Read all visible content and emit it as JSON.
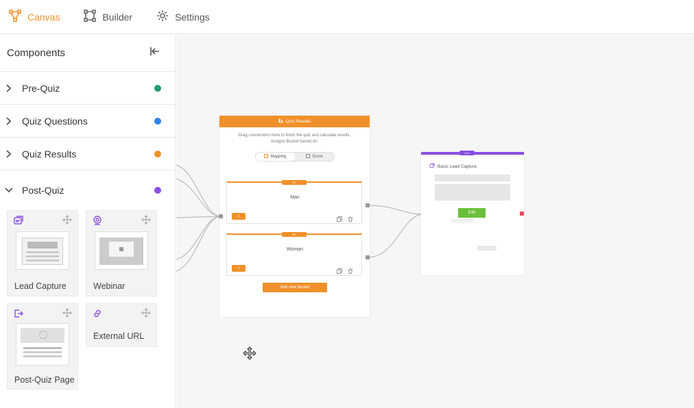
{
  "nav": {
    "tabs": [
      {
        "label": "Canvas",
        "icon": "canvas-icon",
        "active": true
      },
      {
        "label": "Builder",
        "icon": "builder-icon",
        "active": false
      },
      {
        "label": "Settings",
        "icon": "gear-icon",
        "active": false
      }
    ]
  },
  "sidebar": {
    "title": "Components",
    "categories": [
      {
        "label": "Pre-Quiz",
        "color": "#1f9d6b"
      },
      {
        "label": "Quiz Questions",
        "color": "#2f80ed"
      },
      {
        "label": "Quiz Results",
        "color": "#f0902a"
      },
      {
        "label": "Post-Quiz",
        "color": "#8a4fe0"
      }
    ],
    "tiles": [
      {
        "label": "Lead Capture",
        "icon": "lead-capture-icon"
      },
      {
        "label": "Webinar",
        "icon": "webinar-icon"
      },
      {
        "label": "Post-Quiz Page",
        "icon": "exit-page-icon"
      },
      {
        "label": "External URL",
        "icon": "link-icon"
      }
    ]
  },
  "canvas": {
    "quiz_results_node": {
      "title": "Quiz Results",
      "description_line1": "Drag connections here to finish the quiz and calculate results.",
      "description_line2": "Assigns Bucket based on:",
      "toggle": {
        "mapping": "Mapping",
        "score": "Score"
      },
      "buckets": [
        {
          "number": "B1",
          "name": "Man",
          "badge": "1"
        },
        {
          "number": "B2",
          "name": "Woman",
          "badge": "1"
        }
      ],
      "add_button": "Add new bucket"
    },
    "lead_capture_node": {
      "tag": "LC1",
      "title": "Basic Lead Capture",
      "edit_button": "Edit"
    }
  },
  "colors": {
    "accent": "#f0902a",
    "purple": "#8a4fe0",
    "green": "#6bbf3b"
  }
}
